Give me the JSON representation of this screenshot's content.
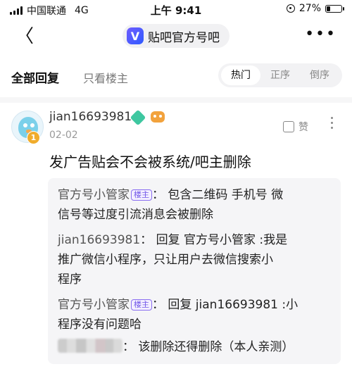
{
  "status_bar": {
    "carrier": "中国联通",
    "network": "4G",
    "time": "上午 9:41",
    "battery": "27%",
    "battery_level": 0.27
  },
  "nav": {
    "back_symbol": "〈",
    "title_logo_letter": "V",
    "title": "贴吧官方号吧",
    "more_symbol": "•••"
  },
  "sort": {
    "all_replies": "全部回复",
    "only_op": "只看楼主",
    "options": [
      "热门",
      "正序",
      "倒序"
    ],
    "active": "热门"
  },
  "post": {
    "username": "jian16693981",
    "level": "1",
    "date": "02-02",
    "like_label": "赞",
    "content": "发广告贴会不会被系统/吧主删除"
  },
  "replies": [
    {
      "who": "官方号小管家",
      "tag": "楼主",
      "sep": "：",
      "text_l1": "包含二维码 手机号 微",
      "text_l2": "信号等过度引流消息会被删除"
    },
    {
      "who": "jian16693981",
      "sep": "：",
      "text_l1": "回复 官方号小管家 :我是",
      "text_l2": "推广微信小程序，只让用户去微信搜索小",
      "text_l3": "程序"
    },
    {
      "who": "官方号小管家",
      "tag": "楼主",
      "sep": "：",
      "text_l1": "回复 jian16693981 :小",
      "text_l2": "程序没有问题哈"
    },
    {
      "sep": "：",
      "text_l1": "该删除还得删除（本人亲测）"
    }
  ],
  "colors": {
    "accent": "#6f55e8",
    "level_badge": "#f0ac2c",
    "gem_badge": "#3ec7a0"
  }
}
